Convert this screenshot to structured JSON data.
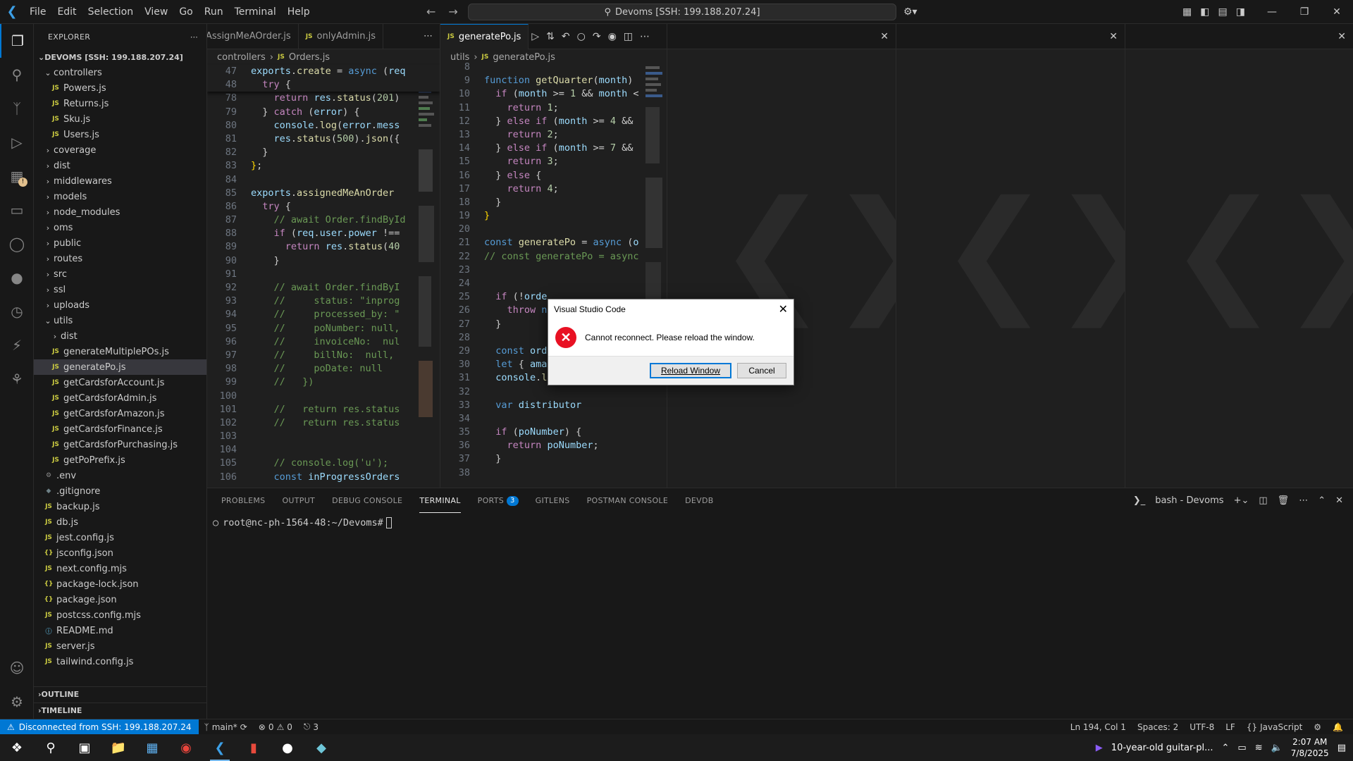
{
  "titlebar": {
    "menu": [
      "File",
      "Edit",
      "Selection",
      "View",
      "Go",
      "Run",
      "Terminal",
      "Help"
    ],
    "command_center": "Devoms [SSH: 199.188.207.24]"
  },
  "explorer": {
    "title": "EXPLORER",
    "root": "DEVOMS [SSH: 199.188.207.24]",
    "tree": [
      {
        "type": "folder-open",
        "label": "controllers",
        "indent": 1
      },
      {
        "type": "js",
        "label": "Powers.js",
        "indent": 2
      },
      {
        "type": "js",
        "label": "Returns.js",
        "indent": 2
      },
      {
        "type": "js",
        "label": "Sku.js",
        "indent": 2
      },
      {
        "type": "js",
        "label": "Users.js",
        "indent": 2
      },
      {
        "type": "folder",
        "label": "coverage",
        "indent": 1
      },
      {
        "type": "folder",
        "label": "dist",
        "indent": 1
      },
      {
        "type": "folder",
        "label": "middlewares",
        "indent": 1
      },
      {
        "type": "folder",
        "label": "models",
        "indent": 1
      },
      {
        "type": "folder",
        "label": "node_modules",
        "indent": 1
      },
      {
        "type": "folder",
        "label": "oms",
        "indent": 1
      },
      {
        "type": "folder",
        "label": "public",
        "indent": 1
      },
      {
        "type": "folder",
        "label": "routes",
        "indent": 1
      },
      {
        "type": "folder",
        "label": "src",
        "indent": 1
      },
      {
        "type": "folder",
        "label": "ssl",
        "indent": 1
      },
      {
        "type": "folder",
        "label": "uploads",
        "indent": 1
      },
      {
        "type": "folder-open",
        "label": "utils",
        "indent": 1
      },
      {
        "type": "folder",
        "label": "dist",
        "indent": 2
      },
      {
        "type": "js",
        "label": "generateMultiplePOs.js",
        "indent": 2
      },
      {
        "type": "js",
        "label": "generatePo.js",
        "indent": 2,
        "selected": true
      },
      {
        "type": "js",
        "label": "getCardsforAccount.js",
        "indent": 2
      },
      {
        "type": "js",
        "label": "getCardsforAdmin.js",
        "indent": 2
      },
      {
        "type": "js",
        "label": "getCardsforAmazon.js",
        "indent": 2
      },
      {
        "type": "js",
        "label": "getCardsforFinance.js",
        "indent": 2
      },
      {
        "type": "js",
        "label": "getCardsforPurchasing.js",
        "indent": 2
      },
      {
        "type": "js",
        "label": "getPoPrefix.js",
        "indent": 2
      },
      {
        "type": "gear",
        "label": ".env",
        "indent": 1
      },
      {
        "type": "dot",
        "label": ".gitignore",
        "indent": 1
      },
      {
        "type": "js",
        "label": "backup.js",
        "indent": 1
      },
      {
        "type": "js",
        "label": "db.js",
        "indent": 1
      },
      {
        "type": "js",
        "label": "jest.config.js",
        "indent": 1
      },
      {
        "type": "json",
        "label": "jsconfig.json",
        "indent": 1
      },
      {
        "type": "js",
        "label": "next.config.mjs",
        "indent": 1
      },
      {
        "type": "json",
        "label": "package-lock.json",
        "indent": 1
      },
      {
        "type": "json",
        "label": "package.json",
        "indent": 1
      },
      {
        "type": "js",
        "label": "postcss.config.mjs",
        "indent": 1
      },
      {
        "type": "info",
        "label": "README.md",
        "indent": 1
      },
      {
        "type": "js",
        "label": "server.js",
        "indent": 1
      },
      {
        "type": "js",
        "label": "tailwind.config.js",
        "indent": 1
      }
    ],
    "outline": "OUTLINE",
    "timeline": "TIMELINE"
  },
  "editor1": {
    "tabs": [
      "AssignMeAOrder.js",
      "onlyAdmin.js"
    ],
    "breadcrumb": [
      "controllers",
      "Orders.js"
    ],
    "sticky": [
      {
        "n": "47",
        "html": "<span class='tok-var'>exports</span>.<span class='tok-fn'>create</span> = <span class='tok-kw'>async</span> (<span class='tok-var'>req</span>"
      },
      {
        "n": "48",
        "html": "  <span class='tok-ctl'>try</span> {"
      }
    ],
    "lines": [
      {
        "n": "78",
        "html": "    <span class='tok-ctl'>return</span> <span class='tok-var'>res</span>.<span class='tok-fn'>status</span>(<span class='tok-num'>201</span>)"
      },
      {
        "n": "79",
        "html": "  } <span class='tok-ctl'>catch</span> (<span class='tok-var'>error</span>) {"
      },
      {
        "n": "80",
        "html": "    <span class='tok-var'>console</span>.<span class='tok-fn'>log</span>(<span class='tok-var'>error</span>.<span class='tok-var'>mess</span>"
      },
      {
        "n": "81",
        "html": "    <span class='tok-var'>res</span>.<span class='tok-fn'>status</span>(<span class='tok-num'>500</span>).<span class='tok-fn'>json</span>({"
      },
      {
        "n": "82",
        "html": "  }"
      },
      {
        "n": "83",
        "html": "<span class='tok-br'>}</span>;"
      },
      {
        "n": "84",
        "html": ""
      },
      {
        "n": "85",
        "html": "<span class='tok-var'>exports</span>.<span class='tok-fn'>assignedMeAnOrder</span>"
      },
      {
        "n": "86",
        "html": "  <span class='tok-ctl'>try</span> {"
      },
      {
        "n": "87",
        "html": "    <span class='tok-cm'>// await Order.findById</span>"
      },
      {
        "n": "88",
        "html": "    <span class='tok-ctl'>if</span> (<span class='tok-var'>req</span>.<span class='tok-var'>user</span>.<span class='tok-var'>power</span> !=="
      },
      {
        "n": "89",
        "html": "      <span class='tok-ctl'>return</span> <span class='tok-var'>res</span>.<span class='tok-fn'>status</span>(<span class='tok-num'>40</span>"
      },
      {
        "n": "90",
        "html": "    }"
      },
      {
        "n": "91",
        "html": ""
      },
      {
        "n": "92",
        "html": "    <span class='tok-cm'>// await Order.findByI</span>"
      },
      {
        "n": "93",
        "html": "    <span class='tok-cm'>//     status: \"inprog</span>"
      },
      {
        "n": "94",
        "html": "    <span class='tok-cm'>//     processed_by: \"</span>"
      },
      {
        "n": "95",
        "html": "    <span class='tok-cm'>//     poNumber: null,</span>"
      },
      {
        "n": "96",
        "html": "    <span class='tok-cm'>//     invoiceNo:  nul</span>"
      },
      {
        "n": "97",
        "html": "    <span class='tok-cm'>//     billNo:  null,</span>"
      },
      {
        "n": "98",
        "html": "    <span class='tok-cm'>//     poDate: null</span>"
      },
      {
        "n": "99",
        "html": "    <span class='tok-cm'>//   })</span>"
      },
      {
        "n": "100",
        "html": ""
      },
      {
        "n": "101",
        "html": "    <span class='tok-cm'>//   return res.status</span>"
      },
      {
        "n": "102",
        "html": "    <span class='tok-cm'>//   return res.status</span>"
      },
      {
        "n": "103",
        "html": ""
      },
      {
        "n": "104",
        "html": ""
      },
      {
        "n": "105",
        "html": "    <span class='tok-cm'>// console.log('u');</span>"
      },
      {
        "n": "106",
        "html": "    <span class='tok-kw'>const</span> <span class='tok-var'>inProgressOrders</span>"
      }
    ]
  },
  "editor2": {
    "tab": "generatePo.js",
    "breadcrumb": [
      "utils",
      "generatePo.js"
    ],
    "lines": [
      {
        "n": "8",
        "html": ""
      },
      {
        "n": "9",
        "html": "<span class='tok-kw'>function</span> <span class='tok-fn'>getQuarter</span>(<span class='tok-var'>month</span>)"
      },
      {
        "n": "10",
        "html": "  <span class='tok-ctl'>if</span> (<span class='tok-var'>month</span> >= <span class='tok-num'>1</span> && <span class='tok-var'>month</span> <"
      },
      {
        "n": "11",
        "html": "    <span class='tok-ctl'>return</span> <span class='tok-num'>1</span>;"
      },
      {
        "n": "12",
        "html": "  } <span class='tok-ctl'>else if</span> (<span class='tok-var'>month</span> >= <span class='tok-num'>4</span> &&"
      },
      {
        "n": "13",
        "html": "    <span class='tok-ctl'>return</span> <span class='tok-num'>2</span>;"
      },
      {
        "n": "14",
        "html": "  } <span class='tok-ctl'>else if</span> (<span class='tok-var'>month</span> >= <span class='tok-num'>7</span> &&"
      },
      {
        "n": "15",
        "html": "    <span class='tok-ctl'>return</span> <span class='tok-num'>3</span>;"
      },
      {
        "n": "16",
        "html": "  } <span class='tok-ctl'>else</span> {"
      },
      {
        "n": "17",
        "html": "    <span class='tok-ctl'>return</span> <span class='tok-num'>4</span>;"
      },
      {
        "n": "18",
        "html": "  }"
      },
      {
        "n": "19",
        "html": "<span class='tok-br'>}</span>"
      },
      {
        "n": "20",
        "html": ""
      },
      {
        "n": "21",
        "html": "<span class='tok-kw'>const</span> <span class='tok-fn'>generatePo</span> = <span class='tok-kw'>async</span> (<span class='tok-var'>o</span>"
      },
      {
        "n": "22",
        "html": "<span class='tok-cm'>// const generatePo = async</span>"
      },
      {
        "n": "23",
        "html": ""
      },
      {
        "n": "24",
        "html": ""
      },
      {
        "n": "25",
        "html": "  <span class='tok-ctl'>if</span> (!<span class='tok-var'>orde</span>"
      },
      {
        "n": "26",
        "html": "    <span class='tok-ctl'>throw</span> <span class='tok-kw'>ne</span>"
      },
      {
        "n": "27",
        "html": "  }"
      },
      {
        "n": "28",
        "html": ""
      },
      {
        "n": "29",
        "html": "  <span class='tok-kw'>const</span> <span class='tok-var'>ord</span>"
      },
      {
        "n": "30",
        "html": "  <span class='tok-kw'>let</span> { <span class='tok-var'>ama</span>"
      },
      {
        "n": "31",
        "html": "  <span class='tok-var'>console</span>.<span class='tok-fn'>log</span>(<span class='tok-str'>\"poNumber\"</span>, <span class='tok-var'>p</span>"
      },
      {
        "n": "32",
        "html": ""
      },
      {
        "n": "33",
        "html": "  <span class='tok-kw'>var</span> <span class='tok-var'>distributor</span>"
      },
      {
        "n": "34",
        "html": ""
      },
      {
        "n": "35",
        "html": "  <span class='tok-ctl'>if</span> (<span class='tok-var'>poNumber</span>) {"
      },
      {
        "n": "36",
        "html": "    <span class='tok-ctl'>return</span> <span class='tok-var'>poNumber</span>;"
      },
      {
        "n": "37",
        "html": "  }"
      },
      {
        "n": "38",
        "html": ""
      }
    ]
  },
  "panel": {
    "tabs": [
      {
        "label": "PROBLEMS"
      },
      {
        "label": "OUTPUT"
      },
      {
        "label": "DEBUG CONSOLE"
      },
      {
        "label": "TERMINAL",
        "active": true
      },
      {
        "label": "PORTS",
        "badge": "3"
      },
      {
        "label": "GITLENS"
      },
      {
        "label": "POSTMAN CONSOLE"
      },
      {
        "label": "DEVDB"
      }
    ],
    "shell": "bash - Devoms",
    "prompt": "root@nc-ph-1564-48:~/Devoms#"
  },
  "statusbar": {
    "remote": "Disconnected from SSH: 199.188.207.24",
    "branch": "main*",
    "errors": "0",
    "warnings": "0",
    "ports": "3",
    "position": "Ln 194, Col 1",
    "spaces": "Spaces: 2",
    "encoding": "UTF-8",
    "eol": "LF",
    "language": "JavaScript"
  },
  "dialog": {
    "title": "Visual Studio Code",
    "message": "Cannot reconnect. Please reload the window.",
    "primary": "Reload Window",
    "secondary": "Cancel"
  },
  "taskbar": {
    "media": "10-year-old guitar-pl...",
    "time": "2:07 AM",
    "date": "7/8/2025"
  }
}
